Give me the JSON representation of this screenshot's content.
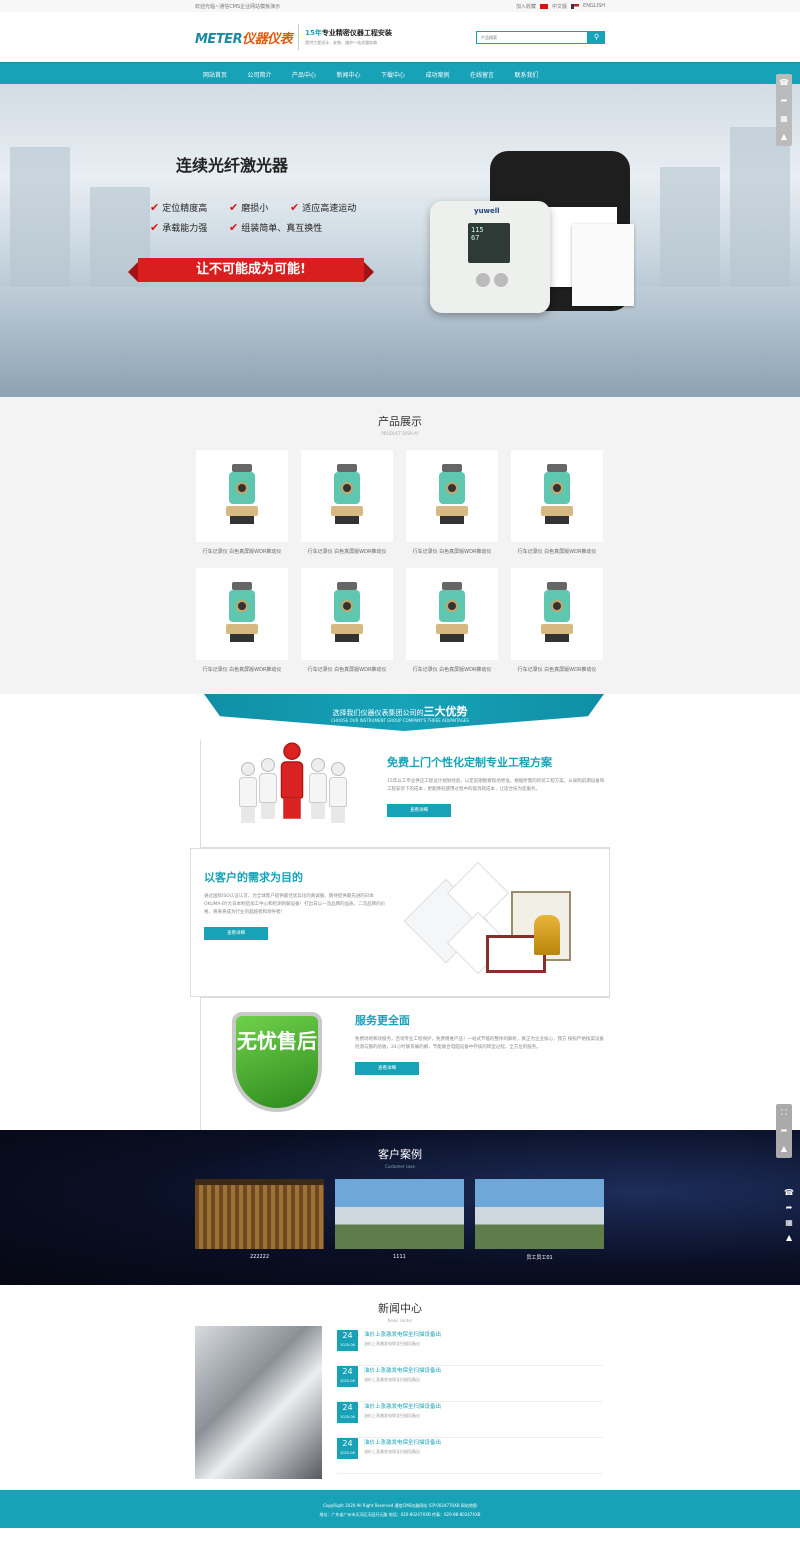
{
  "topbar": {
    "welcome": "欢迎光临~通信CMS企业网站模板演示",
    "favorite": "加入收藏",
    "lang_cn": "中文版",
    "lang_en": "ENGLISH"
  },
  "header": {
    "logo_en": "METER",
    "logo_cn": "仪器仪表",
    "slogan_num": "15年",
    "slogan_title": "专业精密仪器工程安装",
    "slogan_sub": "提供工程设计、安装、维护一站式服务商",
    "search_placeholder": "产品搜索"
  },
  "nav": [
    "网站首页",
    "公司简介",
    "产品中心",
    "新闻中心",
    "下载中心",
    "成功案例",
    "在线留言",
    "联系我们"
  ],
  "hero": {
    "title": "连续光纤激光器",
    "features": [
      "定位精度高",
      "磨损小",
      "适应高速运动",
      "承载能力强",
      "组装简单、真互换性"
    ],
    "ribbon": "让不可能成为可能!",
    "device_brand": "yuwell",
    "screen_line1": "115",
    "screen_line2": "67"
  },
  "products": {
    "title": "产品展示",
    "subtitle": "PRODUCT DISPLAY",
    "items": [
      "行车记录仪 白色真屏版WDR推动仪",
      "行车记录仪 白色真屏版WDR推动仪",
      "行车记录仪 白色真屏版WDR推动仪",
      "行车记录仪 白色真屏版WDR推动仪",
      "行车记录仪 白色真屏版WDR推动仪",
      "行车记录仪 白色真屏版WDR推动仪",
      "行车记录仪 白色真屏版WDR推动仪",
      "行车记录仪 白色真屏版WDR推动仪"
    ]
  },
  "advantages": {
    "title_pre": "选择我们仪器仪表集团公司的",
    "title_bold": "三大优势",
    "subtitle": "CHOOSE OUR INSTRUMENT GROUP COMPANY'S THREE ADVANTAGES",
    "items": [
      {
        "title": "免费上门个性化定制专业工程方案",
        "desc": "15年以工专业供应工程设计规划经验，以定前期勘察现场更准，根据所需的的装工程方案。从采购前期设备和工程安装下的成本，更能降低使用过程中的能消耗成本，让适合技为您服务。",
        "button": "查看详细"
      },
      {
        "title": "以客户的需求为目的",
        "desc": "通过国际ISO认证认可，为全球客户提供最佳优异化的真诚服，期待提供最先进的日本OKUMA-BY大日本制造加工中心和检测的解设备！打出日以一流品牌的品质，二流品牌的价格，将来将成为行业的超越者和领导者！",
        "button": "查看详细"
      },
      {
        "title": "服务更全面",
        "desc": "免费场地和效服务，咨询专业工程保护，免费赠维产品！一站式节能的整体的解析，真正为企业核心，我方 按照严格按案设备检测与额的验收，24小时联系确的解，节能联合电脑设备中存续的转型过程。全方位的服务。",
        "button": "查看详细"
      }
    ],
    "shield_text": "无忧售后"
  },
  "cases": {
    "title": "客户案例",
    "subtitle": "Customer case",
    "items": [
      "222222",
      "1111",
      "员工员工01"
    ]
  },
  "news": {
    "title": "新闻中心",
    "subtitle": "News center",
    "items": [
      {
        "day": "24",
        "month": "2020-06",
        "title": "油价上涨激发电保全扫描设备出",
        "desc": "油价上涨激发电保全扫描设备出"
      },
      {
        "day": "24",
        "month": "2020-06",
        "title": "油价上涨激发电保全扫描设备出",
        "desc": "油价上涨激发电保全扫描设备出"
      },
      {
        "day": "24",
        "month": "2020-06",
        "title": "油价上涨激发电保全扫描设备出",
        "desc": "油价上涨激发电保全扫描设备出"
      },
      {
        "day": "24",
        "month": "2020-06",
        "title": "油价上涨激发电保全扫描设备出",
        "desc": "油价上涨激发电保全扫描设备出"
      }
    ]
  },
  "footer": {
    "line1": "CopyRight 2020 All Right Reserved 通信CMS仪器网站 ICP:0024770XB 网站地图",
    "line2": "地址：广东省广州市天河区天园开元路  电话：020-80247XXB  传真：020-88-80247XXB"
  },
  "colors": {
    "accent": "#17a2b8",
    "red": "#d81e1e"
  }
}
